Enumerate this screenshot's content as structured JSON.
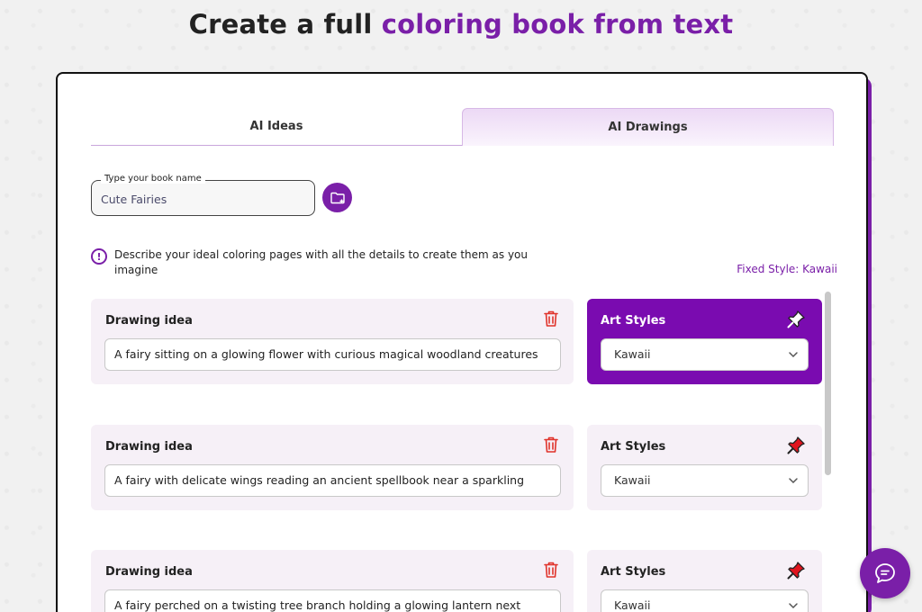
{
  "header": {
    "title_prefix": "Create a full ",
    "title_accent": "coloring book from text"
  },
  "tabs": [
    {
      "label": "AI Ideas",
      "active": false
    },
    {
      "label": "AI Drawings",
      "active": true
    }
  ],
  "book": {
    "label": "Type your book name",
    "value": "Cute Fairies"
  },
  "info": {
    "text": "Describe your ideal coloring pages with all the details to create them as you imagine",
    "fixed_style": "Fixed Style: Kawaii"
  },
  "drawings": [
    {
      "idea_label": "Drawing idea",
      "idea_text": "A fairy sitting on a glowing flower with curious magical woodland creatures",
      "style_label": "Art Styles",
      "style_value": "Kawaii",
      "pinned": true
    },
    {
      "idea_label": "Drawing idea",
      "idea_text": "A fairy with delicate wings reading an ancient spellbook near a sparkling",
      "style_label": "Art Styles",
      "style_value": "Kawaii",
      "pinned": false
    },
    {
      "idea_label": "Drawing idea",
      "idea_text": "A fairy perched on a twisting tree branch holding a glowing lantern next",
      "style_label": "Art Styles",
      "style_value": "Kawaii",
      "pinned": false
    }
  ],
  "icons": {
    "folder": "folder-add-icon",
    "info": "info-icon",
    "trash": "trash-icon",
    "pin": "pushpin-icon",
    "chevron": "chevron-down-icon",
    "chat": "chat-bubble-icon"
  },
  "colors": {
    "accent": "#7a1fa8",
    "active_style_card": "#7a0bb0",
    "trash": "#e0322a",
    "pin": "#e0141e",
    "card_bg": "#f6f0f7"
  }
}
